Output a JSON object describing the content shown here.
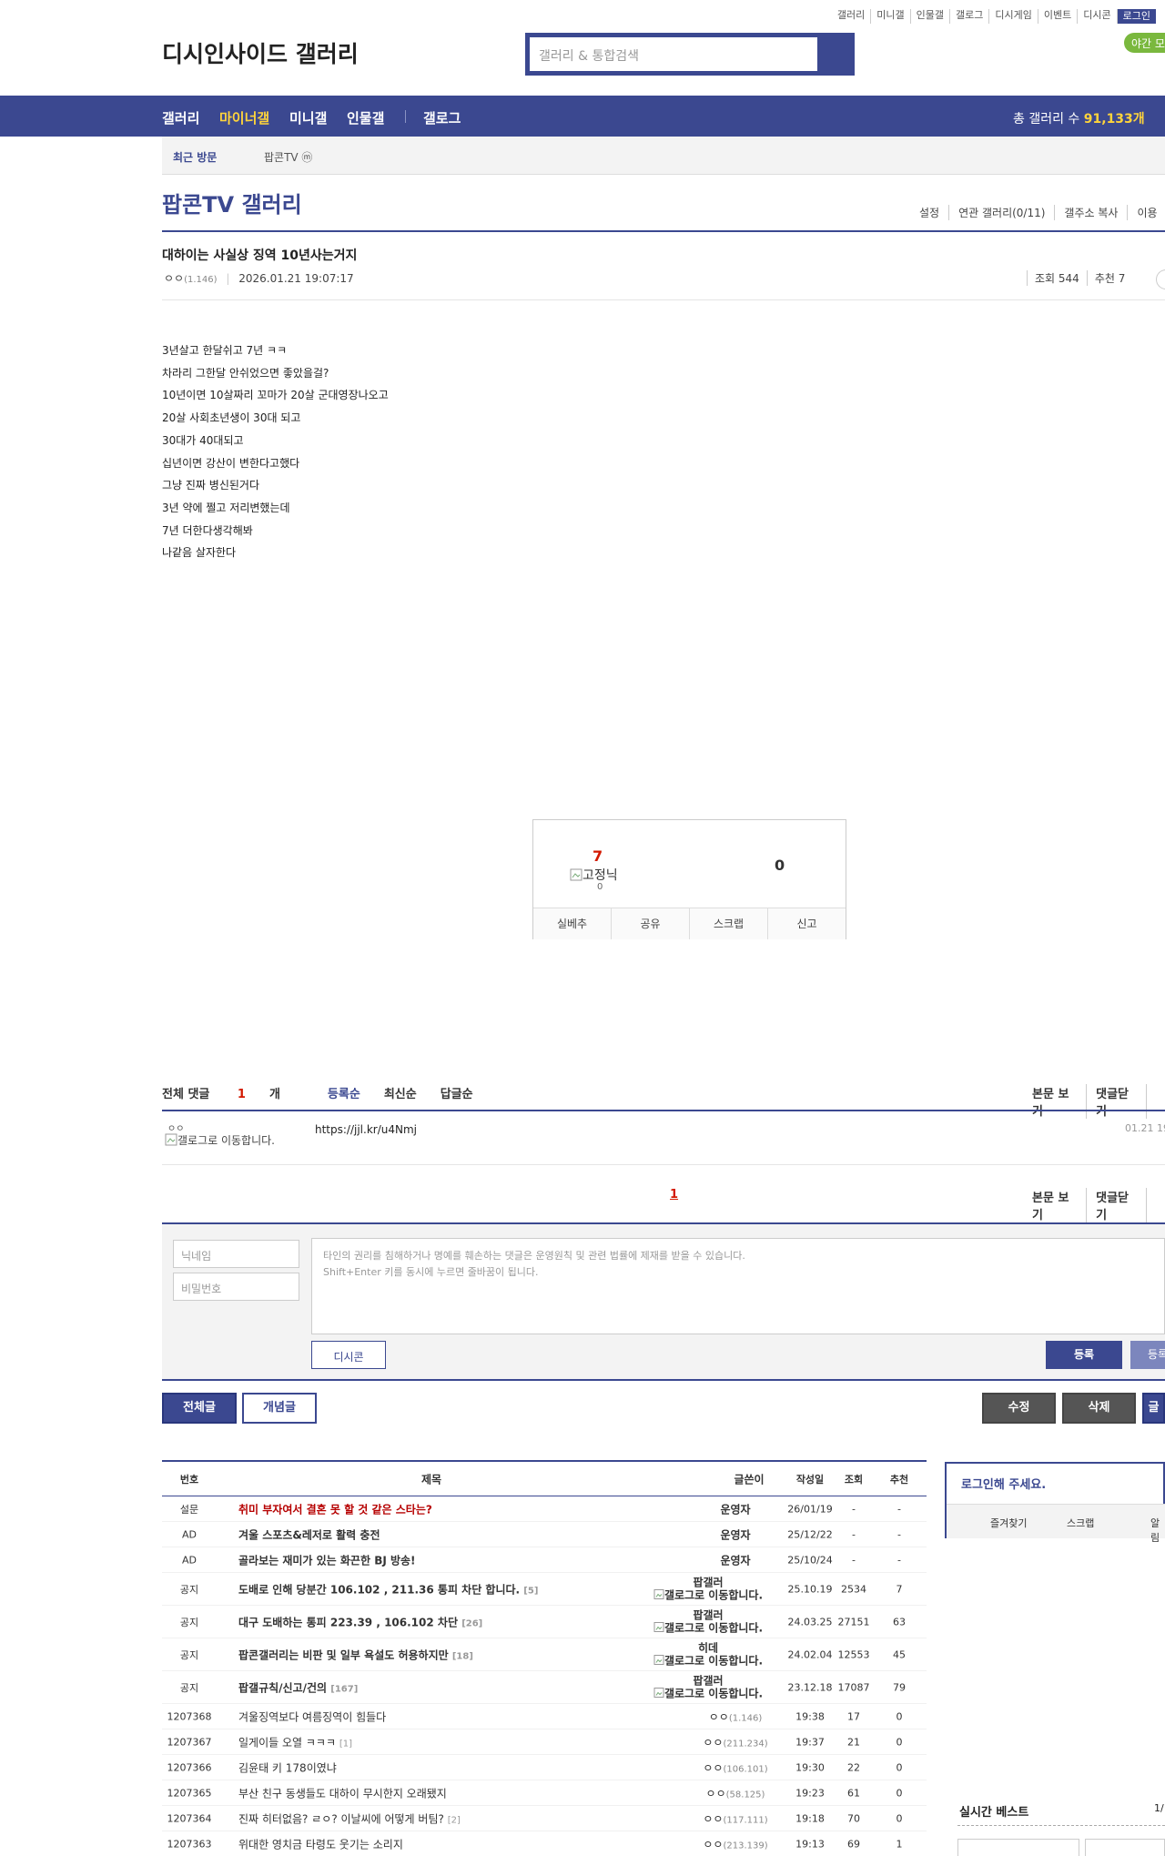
{
  "topnav": [
    "갤러리",
    "미니갤",
    "인물갤",
    "갤로그",
    "디시게임",
    "이벤트",
    "디시콘",
    "로그인"
  ],
  "logo_alt": "디시인사이드 갤러리",
  "search_placeholder": "갤러리 & 통합검색",
  "yagan_label": "야간 모",
  "mainnav": {
    "items": [
      "갤러리",
      "마이너갤",
      "미니갤",
      "인물갤",
      "갤로그"
    ],
    "count_label": "총 갤러리 수",
    "count_value": "91,133개"
  },
  "recent": {
    "label": "최근 방문",
    "item": "팝콘TV ⓜ"
  },
  "gallery_title": "팝콘TV 갤러리",
  "gallery_tools": [
    "설정",
    "연관 갤러리(0/11)",
    "갤주소 복사",
    "이용"
  ],
  "post": {
    "title": "대하이는 사실상 징역 10년사는거지",
    "author": "ㅇㅇ",
    "author_ip": "(1.146)",
    "datetime": "2026.01.21 19:07:17",
    "views": "조회 544",
    "recommends": "추천 7",
    "body": [
      "3년살고 한달쉬고 7년 ㅋㅋ",
      "차라리 그한달 안쉬었으면 좋았을걸?",
      "10년이면 10살짜리 꼬마가 20살 군대영장나오고",
      "20살 사회초년생이 30대 되고",
      "30대가 40대되고",
      "십년이면 강산이 변한다고했다",
      "그냥 진짜 병신된거다",
      "3년 약에 쩔고 저리변했는데",
      "7년 더한다생각해봐",
      "나같음 살자한다"
    ]
  },
  "recommend_box": {
    "up_count": "7",
    "fixed_label": "고정닉",
    "fixed_count": "0",
    "down_count": "0",
    "actions": [
      "실베추",
      "공유",
      "스크랩",
      "신고"
    ]
  },
  "comments": {
    "total_label": "전체 댓글",
    "total_count": "1",
    "total_unit": "개",
    "sorts": [
      "등록순",
      "최신순",
      "답글순"
    ],
    "tools": [
      "본문 보기",
      "댓글닫기"
    ],
    "items": [
      {
        "nick": "ㅇㅇ",
        "gallog": "갤로그로 이동합니다.",
        "memo": "https://jjl.kr/u4Nmj",
        "date": "01.21 19"
      }
    ],
    "page": "1"
  },
  "write": {
    "nick_placeholder": "닉네임",
    "pw_placeholder": "비밀번호",
    "textarea_line1": "타인의 권리를 침해하거나 명예를 훼손하는 댓글은 운영원칙 및 관련 법률에 제재를 받을 수 있습니다.",
    "textarea_line2": "Shift+Enter 키를 동시에 누르면 줄바꿈이 됩니다.",
    "dccon": "디시콘",
    "submit": "등록",
    "submit2": "등록"
  },
  "buttons": {
    "all": "전체글",
    "concept": "개념글",
    "edit": "수정",
    "delete": "삭제",
    "write": "글"
  },
  "list": {
    "headers": [
      "번호",
      "제목",
      "글쓴이",
      "작성일",
      "조회",
      "추천"
    ],
    "rows": [
      {
        "num": "설문",
        "subject": "취미 부자여서 결혼 못 할 것 같은 스타는?",
        "reply": "",
        "writer": "운영자",
        "ip": "",
        "gallog": "",
        "date": "26/01/19",
        "hit": "-",
        "rec": "-",
        "type": "survey"
      },
      {
        "num": "AD",
        "subject": "겨울 스포츠&레저로 활력 충전",
        "reply": "",
        "writer": "운영자",
        "ip": "",
        "gallog": "",
        "date": "25/12/22",
        "hit": "-",
        "rec": "-",
        "type": "ad"
      },
      {
        "num": "AD",
        "subject": "골라보는 재미가 있는 화끈한 BJ 방송!",
        "reply": "",
        "writer": "운영자",
        "ip": "",
        "gallog": "",
        "date": "25/10/24",
        "hit": "-",
        "rec": "-",
        "type": "ad"
      },
      {
        "num": "공지",
        "subject": "도배로 인해 당분간 106.102 , 211.36 통피 차단 합니다.",
        "reply": "[5]",
        "writer": "팝갤러",
        "ip": "",
        "gallog": "갤로그로 이동합니다.",
        "date": "25.10.19",
        "hit": "2534",
        "rec": "7",
        "type": "notice"
      },
      {
        "num": "공지",
        "subject": "대구 도배하는 통피 223.39 , 106.102 차단",
        "reply": "[26]",
        "writer": "팝갤러",
        "ip": "",
        "gallog": "갤로그로 이동합니다.",
        "date": "24.03.25",
        "hit": "27151",
        "rec": "63",
        "type": "notice"
      },
      {
        "num": "공지",
        "subject": "팝콘갤러리는 비판 및 일부 욕설도 허용하지만",
        "reply": "[18]",
        "writer": "히데",
        "ip": "",
        "gallog": "갤로그로 이동합니다.",
        "date": "24.02.04",
        "hit": "12553",
        "rec": "45",
        "type": "notice"
      },
      {
        "num": "공지",
        "subject": "팝갤규칙/신고/건의",
        "reply": "[167]",
        "writer": "팝갤러",
        "ip": "",
        "gallog": "갤로그로 이동합니다.",
        "date": "23.12.18",
        "hit": "17087",
        "rec": "79",
        "type": "notice"
      },
      {
        "num": "1207368",
        "subject": "겨울징역보다 여름징역이 힘들다",
        "reply": "",
        "writer": "ㅇㅇ",
        "ip": "(1.146)",
        "gallog": "",
        "date": "19:38",
        "hit": "17",
        "rec": "0",
        "type": "post"
      },
      {
        "num": "1207367",
        "subject": "일게이들 오열 ㅋㅋㅋ",
        "reply": "[1]",
        "writer": "ㅇㅇ",
        "ip": "(211.234)",
        "gallog": "",
        "date": "19:37",
        "hit": "21",
        "rec": "0",
        "type": "post"
      },
      {
        "num": "1207366",
        "subject": "김윤태 키 178이였냐",
        "reply": "",
        "writer": "ㅇㅇ",
        "ip": "(106.101)",
        "gallog": "",
        "date": "19:30",
        "hit": "22",
        "rec": "0",
        "type": "post"
      },
      {
        "num": "1207365",
        "subject": "부산 친구 동생들도 대하이 무시한지 오래됐지",
        "reply": "",
        "writer": "ㅇㅇ",
        "ip": "(58.125)",
        "gallog": "",
        "date": "19:23",
        "hit": "61",
        "rec": "0",
        "type": "post"
      },
      {
        "num": "1207364",
        "subject": "진짜 히터없음? ㄹㅇ? 이날씨에 어떻게 버팀?",
        "reply": "[2]",
        "writer": "ㅇㅇ",
        "ip": "(117.111)",
        "gallog": "",
        "date": "19:18",
        "hit": "70",
        "rec": "0",
        "type": "post"
      },
      {
        "num": "1207363",
        "subject": "위대한 영치금 타령도 웃기는 소리지",
        "reply": "",
        "writer": "ㅇㅇ",
        "ip": "(213.139)",
        "gallog": "",
        "date": "19:13",
        "hit": "69",
        "rec": "1",
        "type": "post"
      }
    ]
  },
  "sidebar": {
    "login_title": "로그인해 주세요.",
    "tabs": [
      "즐겨찾기",
      "스크랩",
      "알림"
    ],
    "realtime_title": "실시간 베스트",
    "realtime_page": "1/"
  }
}
